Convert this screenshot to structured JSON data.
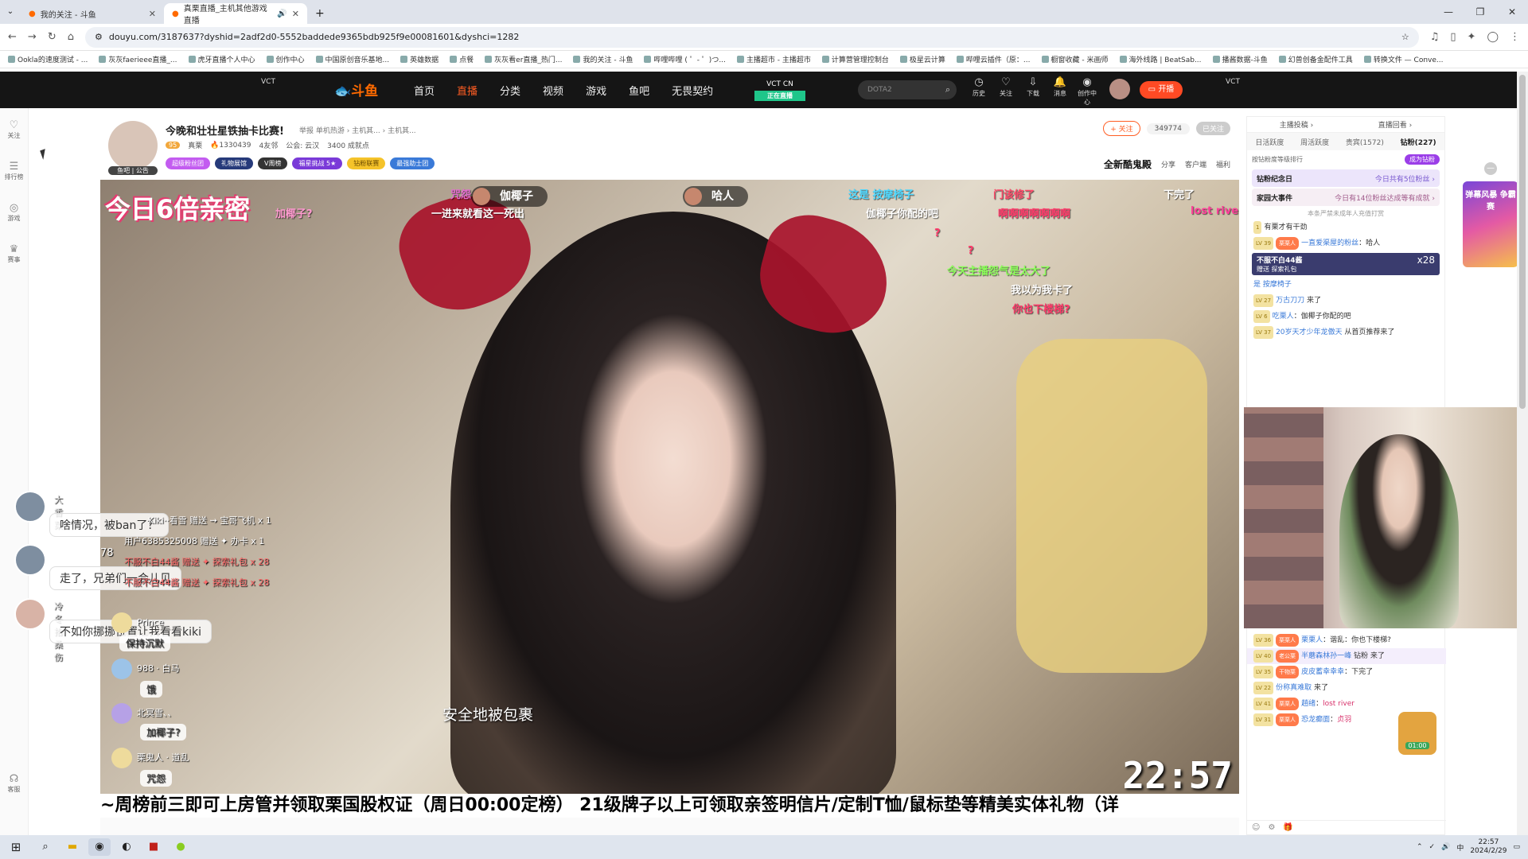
{
  "browser": {
    "tabs": [
      {
        "label": "我的关注 - 斗鱼",
        "active": false
      },
      {
        "label": "真栗直播_主机其他游戏直播",
        "active": true
      }
    ],
    "new_tab": "+",
    "url": "douyu.com/3187637?dyshid=2adf2d0-5552baddede9365bdb925f9e00081601&dyshci=1282",
    "bookmarks": [
      "Ookla的速度测试 - ...",
      "灰灰faerieee直播_...",
      "虎牙直播个人中心",
      "创作中心",
      "中国原创音乐基地...",
      "英雄数据",
      "点餐",
      "灰灰看er直播_热门...",
      "我的关注 - 斗鱼",
      "哔哩哔哩 ( ゜- ゜)つ...",
      "主播超市 - 主播超市",
      "计算营管理控制台",
      "极星云计算",
      "哔哩云插件（原：...",
      "橱窗收藏 - 米画师",
      "海外线路 | BeatSab...",
      "播酱数据-斗鱼",
      "幻兽创备金配件工具",
      "转换文件 — Conve..."
    ]
  },
  "site": {
    "logo": "斗鱼",
    "nav": [
      "首页",
      "直播",
      "分类",
      "视频",
      "游戏",
      "鱼吧",
      "无畏契约"
    ],
    "active_nav": "直播",
    "vct_label": "VCT CN",
    "vct_sub": "正在直播",
    "search_placeholder": "DOTA2",
    "icons": [
      {
        "glyph": "◷",
        "label": "历史"
      },
      {
        "glyph": "♡",
        "label": "关注"
      },
      {
        "glyph": "⇩",
        "label": "下载"
      },
      {
        "glyph": "🔔",
        "label": "消息"
      },
      {
        "glyph": "◉",
        "label": "创作中心"
      }
    ],
    "start_stream": "开播",
    "vct_mark": "VCT"
  },
  "rail": [
    {
      "glyph": "♡",
      "label": "关注"
    },
    {
      "glyph": "☰",
      "label": "排行榜"
    },
    {
      "glyph": "◎",
      "label": "游戏"
    },
    {
      "glyph": "♛",
      "label": "赛事"
    },
    {
      "glyph": "☊",
      "label": "客服"
    }
  ],
  "room": {
    "title": "今晚和壮壮星铁抽卡比赛!",
    "crumbs": "举报  单机热游 › 主机其... › 主机其...",
    "level": "95",
    "host": "真栗",
    "hot": "1330439",
    "fans": "4友邻",
    "guild": "公会: 云汉",
    "points": "3400 成就点",
    "avatar_tags": "鱼吧 | 公告",
    "badges": [
      "超级粉丝团",
      "礼物展馆",
      "V周榜",
      "福星挑战 5★",
      "钻粉联赛",
      "最强助士团"
    ],
    "follow": "+ 关注",
    "followers": "349774",
    "followed": "已关注",
    "tools": [
      "全新酷鬼殿",
      "分享",
      "客户端",
      "福利"
    ]
  },
  "video": {
    "promo": "今日6倍亲密",
    "danmaku": [
      {
        "text": "加椰子?",
        "color": "#ff9ad0"
      },
      {
        "text": "咒怨",
        "color": "#e56bd1"
      },
      {
        "text": "一进来就看这一死出",
        "color": "#ffffff"
      },
      {
        "text": "这是 按摩椅子",
        "color": "#4fd8ff"
      },
      {
        "text": "门该修了",
        "color": "#ff4a6a"
      },
      {
        "text": "下完了",
        "color": "#ffffff"
      },
      {
        "text": "lost river",
        "color": "#ff3f9a"
      },
      {
        "text": "伽椰子你配的吧",
        "color": "#ffffff"
      },
      {
        "text": "啊啊啊啊啊啊啊",
        "color": "#ff3a6a"
      },
      {
        "text": "?",
        "color": "#ff3a6a"
      },
      {
        "text": "?",
        "color": "#ff3a6a"
      },
      {
        "text": "今天主播怨气是太大了",
        "color": "#8cff5a"
      },
      {
        "text": "我以为我卡了",
        "color": "#ffffff"
      },
      {
        "text": "你也下楼梯?",
        "color": "#ff3a6a"
      }
    ],
    "name_caps": [
      "伽椰子",
      "哈人"
    ],
    "subtitle": "安全地被包裹",
    "time": "22:57"
  },
  "overlay_chat": [
    {
      "name": "大香菜",
      "text": "啥情况，被ban了？"
    },
    {
      "name": "",
      "text": "走了，兄弟们一会儿见"
    },
    {
      "name": "冷冬拾桑伤",
      "text": "不如你挪挪位置让我看看kiki"
    }
  ],
  "gifts": [
    {
      "text": "Kiki··看雪 赠送 ⇝ 宝哥飞机 x 1"
    },
    {
      "text": "用户6385325008 赠送 ✦ 办卡 x 1"
    },
    {
      "text": "不服不白44酱 赠送 ✦ 探索礼包 x 28"
    },
    {
      "text": "不服不白44酱 赠送 ✦ 探索礼包 x 28"
    }
  ],
  "gift_counter": "78",
  "small_chat": [
    {
      "name": "Prince",
      "text": "保持沉默"
    },
    {
      "name": "988 · 白马",
      "text": "饿"
    },
    {
      "name": "北冥雪、、",
      "text": "加椰子?"
    },
    {
      "name": "栗鬼人 · 道乱",
      "text": "咒怨"
    }
  ],
  "marquee": "~周榜前三即可上房管并领取栗国股权证（周日00:00定榜） 21级牌子以上可领取亲签明信片/定制T恤/鼠标垫等精美实体礼物（详",
  "right_panel": {
    "top": [
      "主播投稿 ›",
      "直播回看 ›"
    ],
    "tabs": [
      "日活跃度",
      "周活跃度",
      "贵宾(1572)",
      "钻粉(227)"
    ],
    "active_tab": "钻粉(227)",
    "rank_label": "按钻粉度等级排行",
    "become": "成为钻粉",
    "cards": [
      {
        "title": "钻粉纪念日",
        "desc": "今日共有5位粉丝 ›",
        "color": "#ece5fb"
      },
      {
        "title": "家园大事件",
        "desc": "今日有14位粉丝达成等有成就 ›",
        "color": "#f6eef4"
      }
    ],
    "notice": "本条严禁未成年人充值打赏",
    "messages_top": [
      {
        "lv": "1",
        "name": "",
        "text": "有栗才有干劲"
      },
      {
        "lv": "LV 39",
        "name": "一直爱渠屋的粉丝",
        "text": "哈人"
      },
      {
        "lv": "",
        "name": "是 按摩椅子",
        "text": ""
      },
      {
        "lv": "LV 27",
        "name": "万古刀刀",
        "text": "来了"
      },
      {
        "lv": "LV 6",
        "name": "吃栗人",
        "text": "伽椰子你配的吧"
      },
      {
        "lv": "LV 37",
        "name": "20岁天才少年龙傲天",
        "text": "从首页推荐来了"
      }
    ],
    "banner_title": "不服不白44酱",
    "banner_sub": "赠送 探索礼包",
    "banner_count": "x28",
    "messages_bottom": [
      {
        "lv": "LV 36",
        "name": "栗栗人",
        "text": "谐乱：你也下楼梯?"
      },
      {
        "lv": "LV 40",
        "name": "半蘑森林孙一峰",
        "text": "钻粉 来了"
      },
      {
        "lv": "LV 35",
        "name": "皮皮蓄幸幸幸",
        "text": "下完了"
      },
      {
        "lv": "LV 22",
        "name": "份称真难取",
        "text": "来了"
      },
      {
        "lv": "LV 41",
        "name": "趙绪",
        "text": "lost river"
      },
      {
        "lv": "LV 31",
        "name": "恐龙癫面",
        "text": "贞羽"
      }
    ],
    "treasure_time": "01:00",
    "ad": "弹幕风暴 争霸赛",
    "close": "—"
  },
  "taskbar": {
    "time": "22:57",
    "date": "2024/2/29",
    "lang": "中"
  }
}
